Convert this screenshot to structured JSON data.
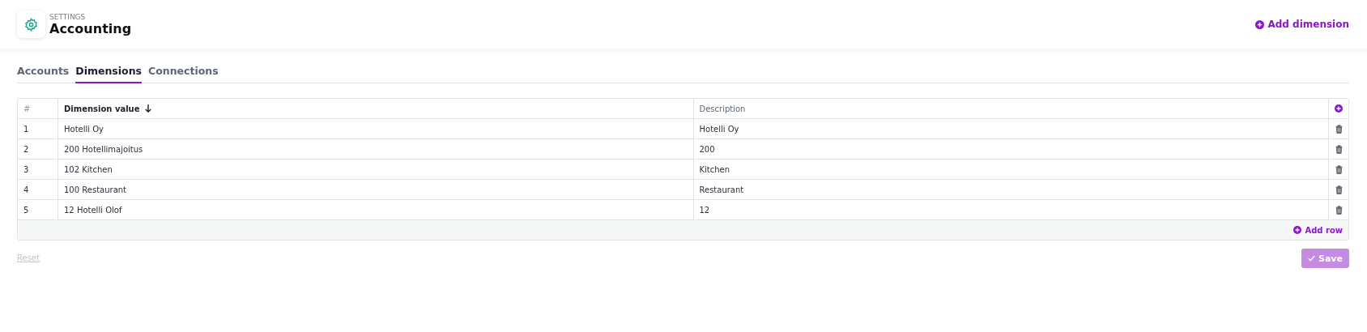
{
  "header": {
    "overline": "SETTINGS",
    "title": "Accounting",
    "action": "Add dimension"
  },
  "tabs": [
    {
      "label": "Accounts",
      "selected": false
    },
    {
      "label": "Dimensions",
      "selected": true
    },
    {
      "label": "Connections",
      "selected": false
    }
  ],
  "table": {
    "columns": [
      {
        "label": "#",
        "sorted": false
      },
      {
        "label": "Dimension value",
        "sorted": true
      },
      {
        "label": "Description",
        "sorted": false
      }
    ],
    "rows": [
      [
        "1",
        "Hotelli Oy",
        "Hotelli Oy"
      ],
      [
        "2",
        "200 Hotellimajoitus",
        "200"
      ],
      [
        "3",
        "102 Kitchen",
        "Kitchen"
      ],
      [
        "4",
        "100 Restaurant",
        "Restaurant"
      ],
      [
        "5",
        "12 Hotelli Olof",
        "12"
      ]
    ],
    "add_row": "Add row"
  },
  "footer": {
    "reset": {
      "label": "Reset",
      "disabled": true
    },
    "save": {
      "label": "Save",
      "disabled": true
    }
  }
}
